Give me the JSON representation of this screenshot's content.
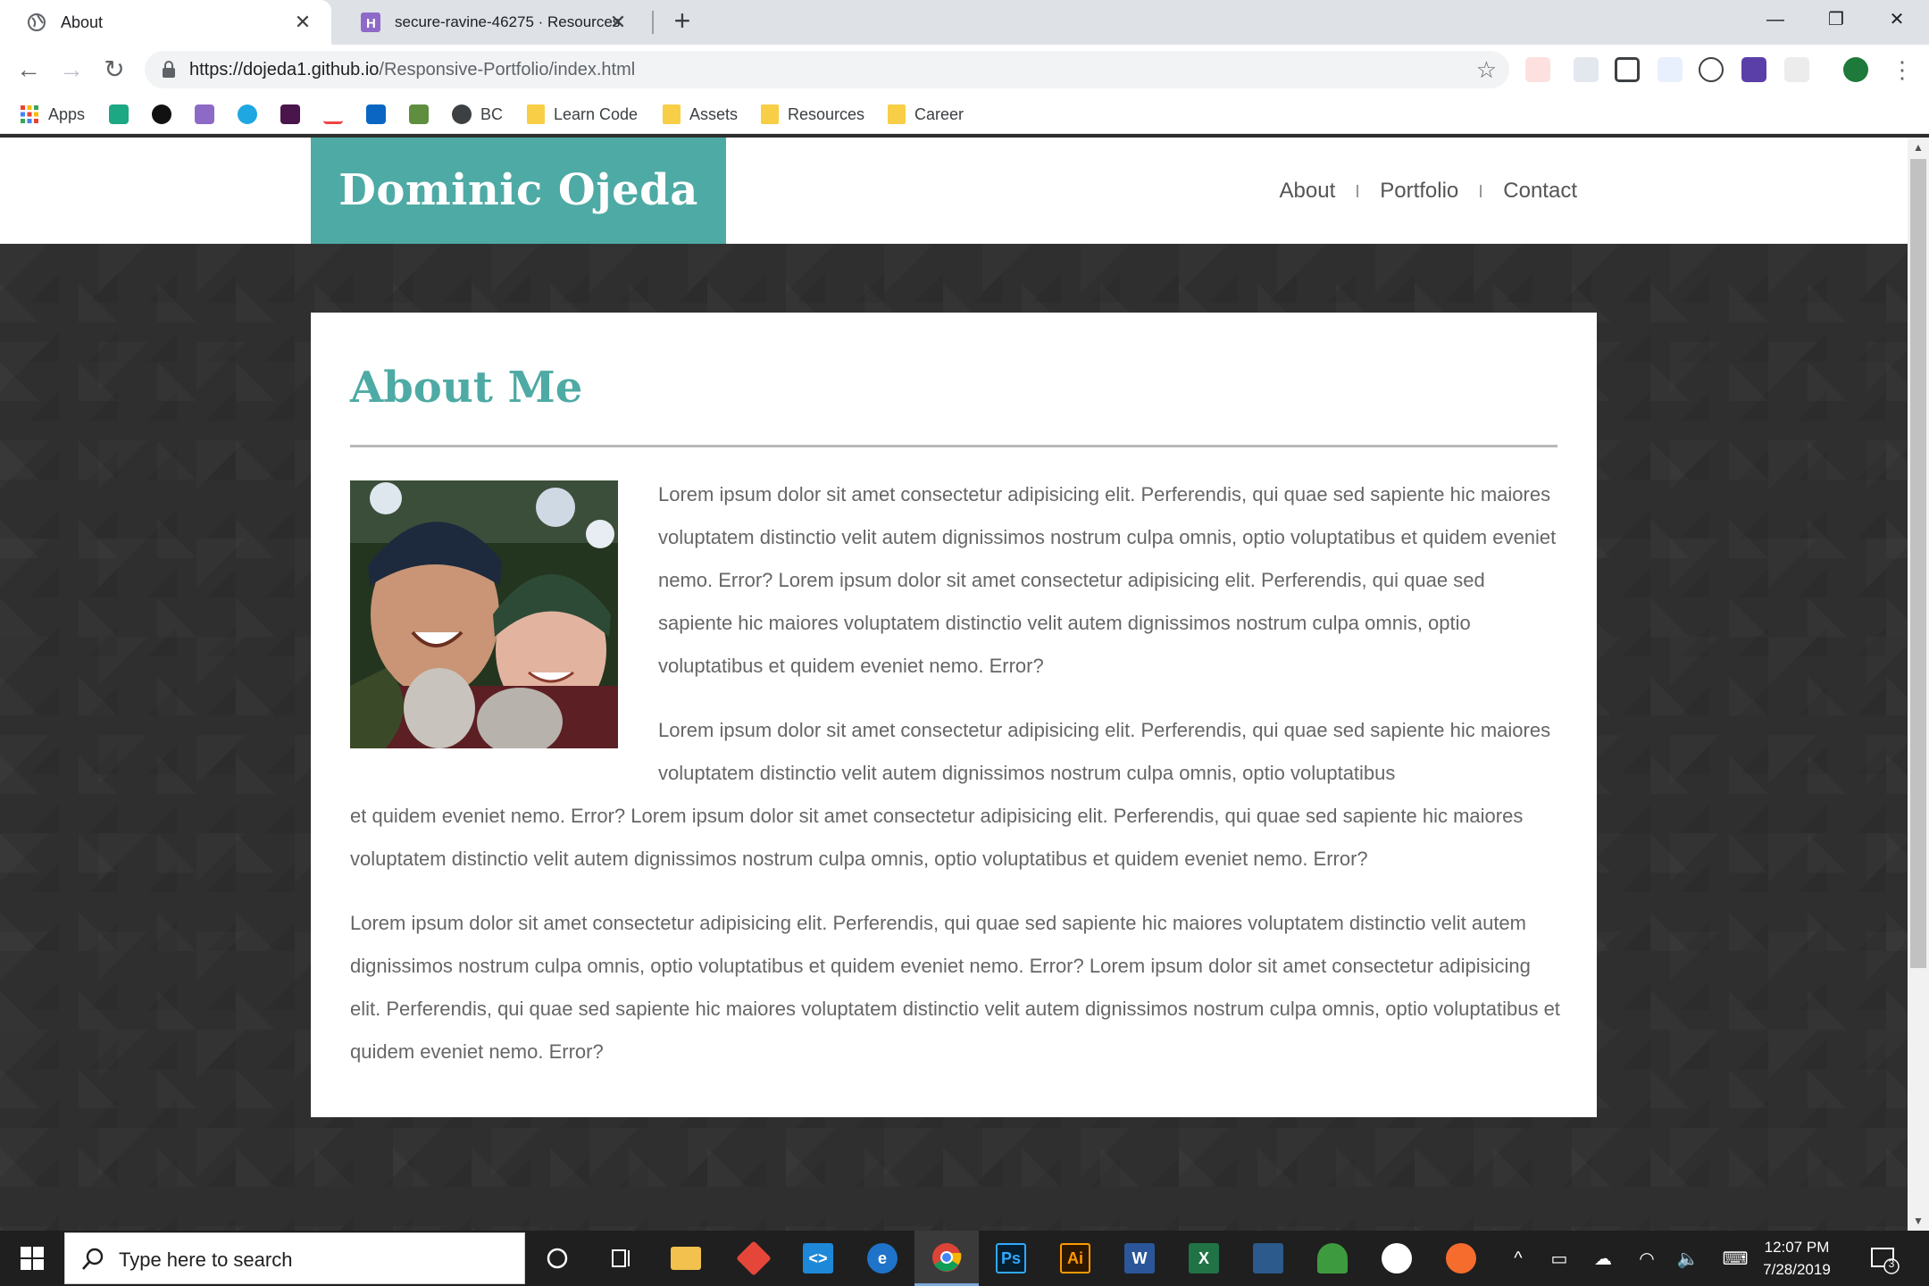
{
  "browser": {
    "tabs": [
      {
        "title": "About",
        "active": true
      },
      {
        "title": "secure-ravine-46275 · Resources",
        "active": false
      }
    ],
    "url_host": "https://dojeda1.github.io",
    "url_path": "/Responsive-Portfolio/index.html",
    "bookmarks": [
      {
        "label": "Apps",
        "icon": "apps-grid-icon"
      },
      {
        "label": "",
        "icon": "gitkraken-icon"
      },
      {
        "label": "",
        "icon": "github-icon"
      },
      {
        "label": "",
        "icon": "heroku-icon"
      },
      {
        "label": "",
        "icon": "hexagon-icon"
      },
      {
        "label": "",
        "icon": "slack-icon"
      },
      {
        "label": "",
        "icon": "brand-icon"
      },
      {
        "label": "",
        "icon": "linkedin-icon"
      },
      {
        "label": "",
        "icon": "shopify-icon"
      },
      {
        "label": "BC",
        "icon": "globe-icon"
      },
      {
        "label": "Learn Code",
        "icon": "folder-icon"
      },
      {
        "label": "Assets",
        "icon": "folder-icon"
      },
      {
        "label": "Resources",
        "icon": "folder-icon"
      },
      {
        "label": "Career",
        "icon": "folder-icon"
      }
    ]
  },
  "site": {
    "brand": "Dominic Ojeda",
    "nav": [
      "About",
      "Portfolio",
      "Contact"
    ],
    "about": {
      "title": "About Me",
      "p1": "Lorem ipsum dolor sit amet consectetur adipisicing elit. Perferendis, qui quae sed sapiente hic maiores voluptatem distinctio velit autem dignissimos nostrum culpa omnis, optio voluptatibus et quidem eveniet nemo. Error? Lorem ipsum dolor sit amet consectetur adipisicing elit. Perferendis, qui quae sed sapiente hic maiores voluptatem distinctio velit autem dignissimos nostrum culpa omnis, optio voluptatibus et quidem eveniet nemo. Error?",
      "p2_top": "Lorem ipsum dolor sit amet consectetur adipisicing elit. Perferendis, qui quae sed sapiente hic maiores voluptatem distinctio velit autem dignissimos nostrum culpa omnis, optio voluptatibus",
      "p2_rest": "et quidem eveniet nemo. Error? Lorem ipsum dolor sit amet consectetur adipisicing elit. Perferendis, qui quae sed sapiente hic maiores voluptatem distinctio velit autem dignissimos nostrum culpa omnis, optio voluptatibus et quidem eveniet nemo. Error?",
      "p3": "Lorem ipsum dolor sit amet consectetur adipisicing elit. Perferendis, qui quae sed sapiente hic maiores voluptatem distinctio velit autem dignissimos nostrum culpa omnis, optio voluptatibus et quidem eveniet nemo. Error? Lorem ipsum dolor sit amet consectetur adipisicing elit. Perferendis, qui quae sed sapiente hic maiores voluptatem distinctio velit autem dignissimos nostrum culpa omnis, optio voluptatibus et quidem eveniet nemo. Error?"
    }
  },
  "taskbar": {
    "search_placeholder": "Type here to search",
    "time": "12:07 PM",
    "date": "7/28/2019",
    "notification_count": "3",
    "apps": [
      "cortana",
      "task-view",
      "file-explorer",
      "git",
      "vscode",
      "edge",
      "chrome",
      "photoshop",
      "illustrator",
      "word",
      "excel",
      "mysql-workbench",
      "robo3t",
      "slack",
      "origin"
    ]
  },
  "colors": {
    "accent": "#4eaaa4",
    "text": "#666666",
    "page_bg": "#2f2f2f"
  }
}
